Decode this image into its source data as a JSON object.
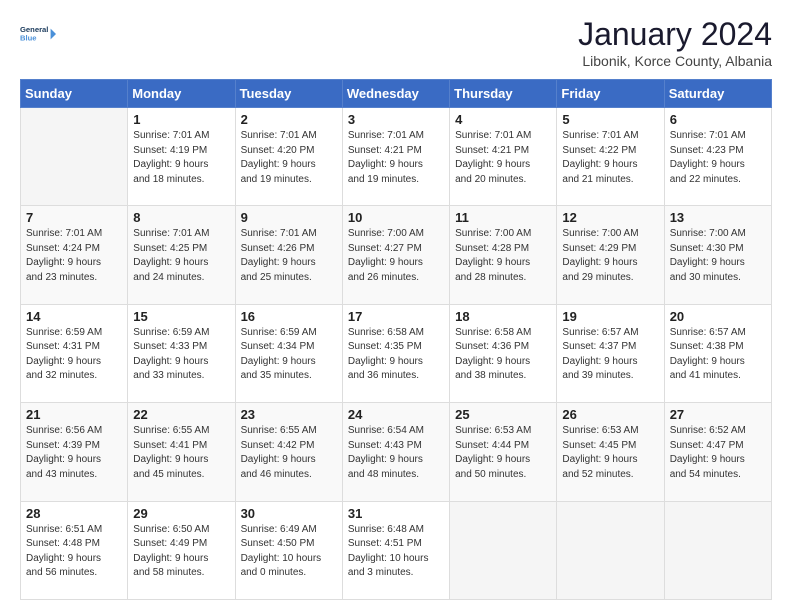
{
  "logo": {
    "line1": "General",
    "line2": "Blue"
  },
  "header": {
    "month": "January 2024",
    "location": "Libonik, Korce County, Albania"
  },
  "weekdays": [
    "Sunday",
    "Monday",
    "Tuesday",
    "Wednesday",
    "Thursday",
    "Friday",
    "Saturday"
  ],
  "weeks": [
    [
      {
        "day": "",
        "content": ""
      },
      {
        "day": "1",
        "content": "Sunrise: 7:01 AM\nSunset: 4:19 PM\nDaylight: 9 hours\nand 18 minutes."
      },
      {
        "day": "2",
        "content": "Sunrise: 7:01 AM\nSunset: 4:20 PM\nDaylight: 9 hours\nand 19 minutes."
      },
      {
        "day": "3",
        "content": "Sunrise: 7:01 AM\nSunset: 4:21 PM\nDaylight: 9 hours\nand 19 minutes."
      },
      {
        "day": "4",
        "content": "Sunrise: 7:01 AM\nSunset: 4:21 PM\nDaylight: 9 hours\nand 20 minutes."
      },
      {
        "day": "5",
        "content": "Sunrise: 7:01 AM\nSunset: 4:22 PM\nDaylight: 9 hours\nand 21 minutes."
      },
      {
        "day": "6",
        "content": "Sunrise: 7:01 AM\nSunset: 4:23 PM\nDaylight: 9 hours\nand 22 minutes."
      }
    ],
    [
      {
        "day": "7",
        "content": ""
      },
      {
        "day": "8",
        "content": "Sunrise: 7:01 AM\nSunset: 4:25 PM\nDaylight: 9 hours\nand 24 minutes."
      },
      {
        "day": "9",
        "content": "Sunrise: 7:01 AM\nSunset: 4:26 PM\nDaylight: 9 hours\nand 25 minutes."
      },
      {
        "day": "10",
        "content": "Sunrise: 7:00 AM\nSunset: 4:27 PM\nDaylight: 9 hours\nand 26 minutes."
      },
      {
        "day": "11",
        "content": "Sunrise: 7:00 AM\nSunset: 4:28 PM\nDaylight: 9 hours\nand 28 minutes."
      },
      {
        "day": "12",
        "content": "Sunrise: 7:00 AM\nSunset: 4:29 PM\nDaylight: 9 hours\nand 29 minutes."
      },
      {
        "day": "13",
        "content": "Sunrise: 7:00 AM\nSunset: 4:30 PM\nDaylight: 9 hours\nand 30 minutes."
      }
    ],
    [
      {
        "day": "14",
        "content": ""
      },
      {
        "day": "15",
        "content": "Sunrise: 6:59 AM\nSunset: 4:33 PM\nDaylight: 9 hours\nand 33 minutes."
      },
      {
        "day": "16",
        "content": "Sunrise: 6:59 AM\nSunset: 4:34 PM\nDaylight: 9 hours\nand 35 minutes."
      },
      {
        "day": "17",
        "content": "Sunrise: 6:58 AM\nSunset: 4:35 PM\nDaylight: 9 hours\nand 36 minutes."
      },
      {
        "day": "18",
        "content": "Sunrise: 6:58 AM\nSunset: 4:36 PM\nDaylight: 9 hours\nand 38 minutes."
      },
      {
        "day": "19",
        "content": "Sunrise: 6:57 AM\nSunset: 4:37 PM\nDaylight: 9 hours\nand 39 minutes."
      },
      {
        "day": "20",
        "content": "Sunrise: 6:57 AM\nSunset: 4:38 PM\nDaylight: 9 hours\nand 41 minutes."
      }
    ],
    [
      {
        "day": "21",
        "content": ""
      },
      {
        "day": "22",
        "content": "Sunrise: 6:55 AM\nSunset: 4:41 PM\nDaylight: 9 hours\nand 45 minutes."
      },
      {
        "day": "23",
        "content": "Sunrise: 6:55 AM\nSunset: 4:42 PM\nDaylight: 9 hours\nand 46 minutes."
      },
      {
        "day": "24",
        "content": "Sunrise: 6:54 AM\nSunset: 4:43 PM\nDaylight: 9 hours\nand 48 minutes."
      },
      {
        "day": "25",
        "content": "Sunrise: 6:53 AM\nSunset: 4:44 PM\nDaylight: 9 hours\nand 50 minutes."
      },
      {
        "day": "26",
        "content": "Sunrise: 6:53 AM\nSunset: 4:45 PM\nDaylight: 9 hours\nand 52 minutes."
      },
      {
        "day": "27",
        "content": "Sunrise: 6:52 AM\nSunset: 4:47 PM\nDaylight: 9 hours\nand 54 minutes."
      }
    ],
    [
      {
        "day": "28",
        "content": ""
      },
      {
        "day": "29",
        "content": "Sunrise: 6:50 AM\nSunset: 4:49 PM\nDaylight: 9 hours\nand 58 minutes."
      },
      {
        "day": "30",
        "content": "Sunrise: 6:49 AM\nSunset: 4:50 PM\nDaylight: 10 hours\nand 0 minutes."
      },
      {
        "day": "31",
        "content": "Sunrise: 6:48 AM\nSunset: 4:51 PM\nDaylight: 10 hours\nand 3 minutes."
      },
      {
        "day": "",
        "content": ""
      },
      {
        "day": "",
        "content": ""
      },
      {
        "day": "",
        "content": ""
      }
    ]
  ],
  "week1_sun": "Sunrise: 7:01 AM\nSunset: 4:24 PM\nDaylight: 9 hours\nand 23 minutes.",
  "week3_sun": "Sunrise: 6:59 AM\nSunset: 4:31 PM\nDaylight: 9 hours\nand 32 minutes.",
  "week4_sun": "Sunrise: 6:56 AM\nSunset: 4:39 PM\nDaylight: 9 hours\nand 43 minutes.",
  "week5_sun": "Sunrise: 6:51 AM\nSunset: 4:48 PM\nDaylight: 9 hours\nand 56 minutes."
}
